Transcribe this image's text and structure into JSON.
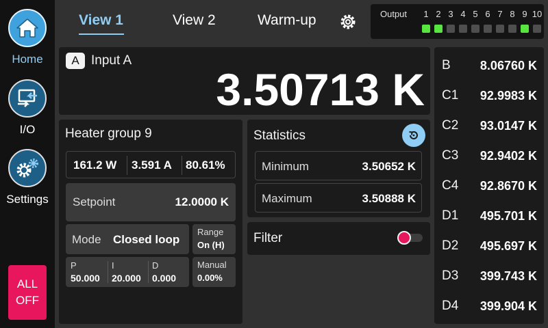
{
  "nav": {
    "home": "Home",
    "io": "I/O",
    "settings": "Settings",
    "all_off_line1": "ALL",
    "all_off_line2": "OFF"
  },
  "tabs": [
    "View 1",
    "View 2",
    "Warm-up"
  ],
  "outputs": {
    "title": "Output",
    "numbers": [
      "1",
      "2",
      "3",
      "4",
      "5",
      "6",
      "7",
      "8",
      "9",
      "10"
    ],
    "states": [
      true,
      true,
      false,
      false,
      false,
      false,
      false,
      false,
      true,
      false
    ]
  },
  "input_a": {
    "badge": "A",
    "label": "Input A",
    "value": "3.50713 K"
  },
  "heater": {
    "title": "Heater group 9",
    "power": "161.2 W",
    "current": "3.591 A",
    "percent": "80.61%",
    "setpoint_label": "Setpoint",
    "setpoint_value": "12.0000 K",
    "mode_label": "Mode",
    "mode_value": "Closed loop",
    "range_label": "Range",
    "range_value": "On (H)",
    "p_label": "P",
    "p_value": "50.000",
    "i_label": "I",
    "i_value": "20.000",
    "d_label": "D",
    "d_value": "0.000",
    "manual_label": "Manual",
    "manual_value": "0.00%"
  },
  "statistics": {
    "title": "Statistics",
    "min_label": "Minimum",
    "min_value": "3.50652 K",
    "max_label": "Maximum",
    "max_value": "3.50888 K"
  },
  "filter": {
    "label": "Filter",
    "enabled": false
  },
  "channels": [
    {
      "name": "B",
      "value": "8.06760 K"
    },
    {
      "name": "C1",
      "value": "92.9983 K"
    },
    {
      "name": "C2",
      "value": "93.0147 K"
    },
    {
      "name": "C3",
      "value": "92.9402 K"
    },
    {
      "name": "C4",
      "value": "92.8670 K"
    },
    {
      "name": "D1",
      "value": "495.701 K"
    },
    {
      "name": "D2",
      "value": "495.697 K"
    },
    {
      "name": "D3",
      "value": "399.743 K"
    },
    {
      "name": "D4",
      "value": "399.904 K"
    }
  ],
  "colors": {
    "accent": "#8fcdf4",
    "led_on": "#56e63f",
    "alert": "#e8175d"
  }
}
